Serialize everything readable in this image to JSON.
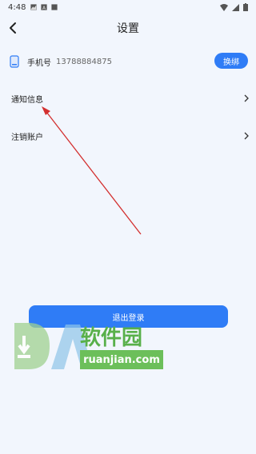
{
  "status_bar": {
    "time": "4:48"
  },
  "header": {
    "title": "设置"
  },
  "phone": {
    "label": "手机号",
    "number": "13788884875",
    "change_label": "换绑"
  },
  "menu": {
    "items": [
      {
        "label": "通知信息"
      },
      {
        "label": "注销账户"
      }
    ]
  },
  "logout_label": "退出登录",
  "watermark": {
    "brand": "软件园",
    "domain": "ruanjian.com"
  },
  "colors": {
    "background": "#f2f6fd",
    "accent": "#2f7cf6",
    "annotation_arrow": "#d32f2f",
    "watermark_green": "#58b04a"
  }
}
